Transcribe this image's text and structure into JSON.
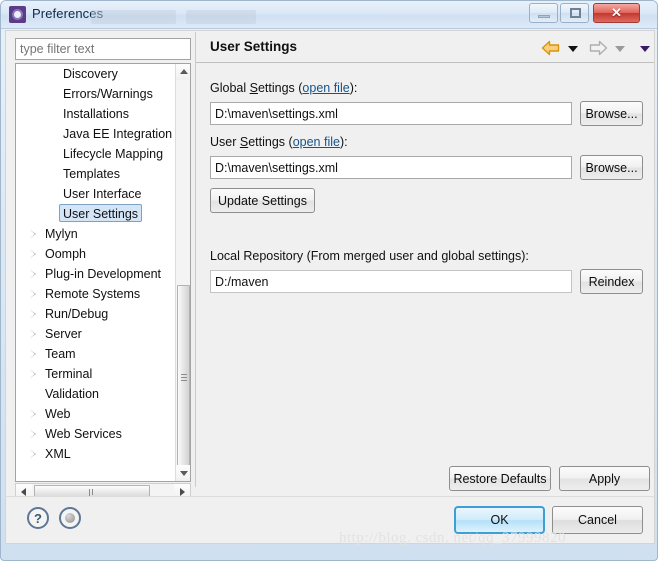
{
  "window": {
    "title": "Preferences",
    "icon": "preferences-gear-icon",
    "buttons": {
      "minimize": "minimize-button",
      "maximize": "maximize-button",
      "close": "✕"
    }
  },
  "sidebar": {
    "filter": {
      "value": "",
      "placeholder": "type filter text"
    },
    "items": [
      {
        "label": "Discovery",
        "level": 2,
        "expandable": false,
        "selected": false
      },
      {
        "label": "Errors/Warnings",
        "level": 2,
        "expandable": false,
        "selected": false
      },
      {
        "label": "Installations",
        "level": 2,
        "expandable": false,
        "selected": false
      },
      {
        "label": "Java EE Integration",
        "level": 2,
        "expandable": false,
        "selected": false
      },
      {
        "label": "Lifecycle Mapping",
        "level": 2,
        "expandable": false,
        "selected": false
      },
      {
        "label": "Templates",
        "level": 2,
        "expandable": false,
        "selected": false
      },
      {
        "label": "User Interface",
        "level": 2,
        "expandable": false,
        "selected": false
      },
      {
        "label": "User Settings",
        "level": 2,
        "expandable": false,
        "selected": true
      },
      {
        "label": "Mylyn",
        "level": 1,
        "expandable": true,
        "selected": false
      },
      {
        "label": "Oomph",
        "level": 1,
        "expandable": true,
        "selected": false
      },
      {
        "label": "Plug-in Development",
        "level": 1,
        "expandable": true,
        "selected": false
      },
      {
        "label": "Remote Systems",
        "level": 1,
        "expandable": true,
        "selected": false
      },
      {
        "label": "Run/Debug",
        "level": 1,
        "expandable": true,
        "selected": false
      },
      {
        "label": "Server",
        "level": 1,
        "expandable": true,
        "selected": false
      },
      {
        "label": "Team",
        "level": 1,
        "expandable": true,
        "selected": false
      },
      {
        "label": "Terminal",
        "level": 1,
        "expandable": true,
        "selected": false
      },
      {
        "label": "Validation",
        "level": 1,
        "expandable": false,
        "selected": false
      },
      {
        "label": "Web",
        "level": 1,
        "expandable": true,
        "selected": false
      },
      {
        "label": "Web Services",
        "level": 1,
        "expandable": true,
        "selected": false
      },
      {
        "label": "XML",
        "level": 1,
        "expandable": true,
        "selected": false
      }
    ]
  },
  "panel": {
    "title": "User Settings",
    "nav": {
      "back_icon": "back-arrow-icon",
      "back_menu_icon": "chevron-down-icon",
      "forward_icon": "forward-arrow-icon",
      "forward_menu_icon": "chevron-down-icon",
      "view_menu_icon": "chevron-down-icon"
    },
    "global_settings": {
      "label_prefix": "Global ",
      "label_mnemonic": "S",
      "label_rest": "ettings (",
      "link": "open file",
      "label_suffix": "):",
      "value": "D:\\maven\\settings.xml",
      "browse_label": "Browse..."
    },
    "user_settings": {
      "label_prefix": "User ",
      "label_mnemonic": "S",
      "label_rest": "ettings (",
      "link": "open file",
      "label_suffix": "):",
      "value": "D:\\maven\\settings.xml",
      "browse_label": "Browse..."
    },
    "update_settings_label": "Update Settings",
    "local_repository": {
      "label": "Local Repository (From merged user and global settings):",
      "value": "D:/maven",
      "reindex_label": "Reindex"
    },
    "restore_defaults_label": "Restore Defaults",
    "apply_label": "Apply"
  },
  "footer": {
    "help_icon": "?",
    "shell_icon": "shell-status-icon",
    "ok_label": "OK",
    "cancel_label": "Cancel"
  },
  "watermark": "http://blog. csdn. net/qq_37999820",
  "colors": {
    "selection_bg": "#d3e5f7",
    "selection_border": "#7da2c4",
    "link": "#16538d",
    "ok_border": "#3c9fd6",
    "close_button": "#c2382f",
    "back_arrow": "#e8a317"
  }
}
